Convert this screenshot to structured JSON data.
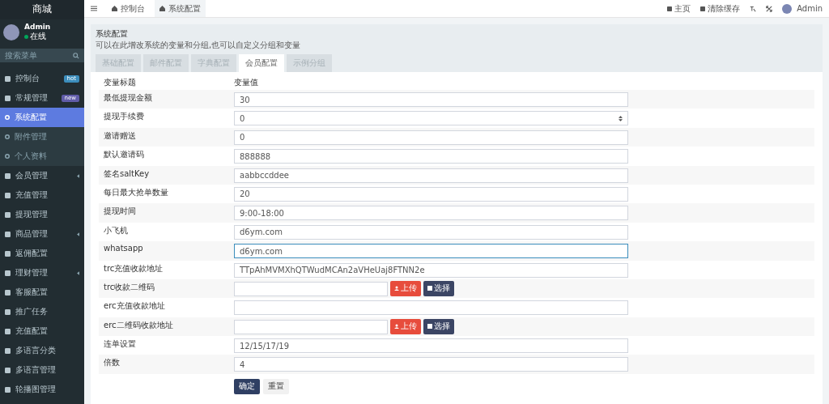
{
  "sidebar": {
    "logo": "商城",
    "user": {
      "name": "Admin",
      "status": "在线"
    },
    "search": {
      "placeholder": "搜索菜单"
    },
    "items": [
      {
        "label": "控制台",
        "badge": "hot",
        "color": "#3c8dbc",
        "selected": false,
        "expandable": false
      },
      {
        "label": "常规管理",
        "badge": "new",
        "color": "#605ca8",
        "selected": false,
        "expandable": false,
        "children": [
          {
            "label": "系统配置",
            "selected": true
          },
          {
            "label": "附件管理",
            "selected": false
          },
          {
            "label": "个人资料",
            "selected": false
          }
        ]
      },
      {
        "label": "会员管理",
        "selected": false,
        "expandable": true
      },
      {
        "label": "充值管理",
        "selected": false,
        "expandable": false
      },
      {
        "label": "提现管理",
        "selected": false,
        "expandable": false
      },
      {
        "label": "商品管理",
        "selected": false,
        "expandable": true
      },
      {
        "label": "返佣配置",
        "selected": false,
        "expandable": false
      },
      {
        "label": "理财管理",
        "selected": false,
        "expandable": true
      },
      {
        "label": "客服配置",
        "selected": false,
        "expandable": false
      },
      {
        "label": "推广任务",
        "selected": false,
        "expandable": false
      },
      {
        "label": "充值配置",
        "selected": false,
        "expandable": false
      },
      {
        "label": "多语言分类",
        "selected": false,
        "expandable": false
      },
      {
        "label": "多语言管理",
        "selected": false,
        "expandable": false
      },
      {
        "label": "轮播图管理",
        "selected": false,
        "expandable": false
      }
    ]
  },
  "topbar": {
    "tabs": [
      {
        "label": "控制台",
        "selected": false
      },
      {
        "label": "系统配置",
        "selected": true
      }
    ],
    "links": [
      {
        "label": "主页"
      },
      {
        "label": "清除缓存"
      }
    ],
    "user": "Admin"
  },
  "panel": {
    "title": "系统配置",
    "description": "可以在此增改系统的变量和分组,也可以自定义分组和变量",
    "tabs": [
      {
        "label": "基础配置",
        "selected": false
      },
      {
        "label": "邮件配置",
        "selected": false
      },
      {
        "label": "字典配置",
        "selected": false
      },
      {
        "label": "会员配置",
        "selected": true
      },
      {
        "label": "示例分组",
        "selected": false
      }
    ],
    "columns": [
      "变量标题",
      "变量值"
    ],
    "rows": [
      {
        "label": "最低提现金额",
        "kind": "text",
        "value": "30",
        "focused": false
      },
      {
        "label": "提现手续费",
        "kind": "select",
        "value": "0",
        "focused": false
      },
      {
        "label": "邀请赠送",
        "kind": "text",
        "value": "0",
        "focused": false
      },
      {
        "label": "默认邀请码",
        "kind": "text",
        "value": "888888",
        "focused": false
      },
      {
        "label": "签名saltKey",
        "kind": "text",
        "value": "aabbccddee",
        "focused": false
      },
      {
        "label": "每日最大抢单数量",
        "kind": "text",
        "value": "20",
        "focused": false
      },
      {
        "label": "提现时间",
        "kind": "text",
        "value": "9:00-18:00",
        "focused": false
      },
      {
        "label": "小飞机",
        "kind": "text",
        "value": "d6ym.com",
        "focused": false
      },
      {
        "label": "whatsapp",
        "kind": "text",
        "value": "d6ym.com",
        "focused": true
      },
      {
        "label": "trc充值收款地址",
        "kind": "text",
        "value": "TTpAhMVMXhQTWudMCAn2aVHeUaj8FTNN2e",
        "focused": false
      },
      {
        "label": "trc收款二维码",
        "kind": "upload",
        "value": "",
        "upload": "上传",
        "choose": "选择",
        "focused": false
      },
      {
        "label": "erc充值收款地址",
        "kind": "text",
        "value": "",
        "focused": false
      },
      {
        "label": "erc二维码收款地址",
        "kind": "upload",
        "value": "",
        "upload": "上传",
        "choose": "选择",
        "focused": false
      },
      {
        "label": "连单设置",
        "kind": "text",
        "value": "12/15/17/19",
        "focused": false
      },
      {
        "label": "倍数",
        "kind": "text",
        "value": "4",
        "focused": false
      }
    ],
    "buttons": {
      "submit": "确定",
      "reset": "重置"
    }
  }
}
